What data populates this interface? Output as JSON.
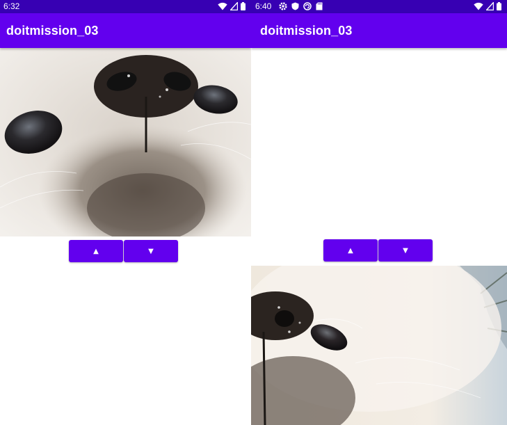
{
  "screens": [
    {
      "status": {
        "time": "6:32"
      },
      "app": {
        "title": "doitmission_03"
      },
      "image": {
        "position": "top"
      },
      "buttons": {
        "up": "▲",
        "down": "▼"
      }
    },
    {
      "status": {
        "time": "6:40"
      },
      "app": {
        "title": "doitmission_03"
      },
      "image": {
        "position": "bottom"
      },
      "buttons": {
        "up": "▲",
        "down": "▼"
      }
    }
  ],
  "colors": {
    "status_bar": "#3700b3",
    "primary": "#6200ee",
    "on_primary": "#ffffff",
    "background": "#ffffff"
  },
  "icons": {
    "status_left": [
      "settings-icon",
      "shield-icon",
      "vpn-icon",
      "sd-card-icon"
    ],
    "status_right": [
      "wifi-icon",
      "cell-signal-icon",
      "battery-icon"
    ],
    "photo": "dog-closeup-photo"
  }
}
